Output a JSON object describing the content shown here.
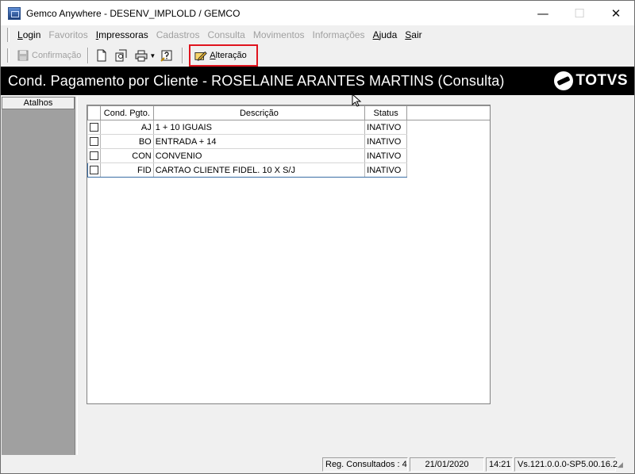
{
  "window": {
    "title": "Gemco Anywhere - DESENV_IMPLOLD / GEMCO",
    "controls": {
      "minimize": "—",
      "maximize": "☐",
      "close": "✕"
    }
  },
  "menubar": {
    "items": [
      {
        "label": "Login",
        "accel": "L",
        "rest": "ogin",
        "enabled": true
      },
      {
        "label": "Favoritos",
        "accel": "F",
        "rest": "avoritos",
        "enabled": false
      },
      {
        "label": "Impressoras",
        "accel": "I",
        "rest": "mpressoras",
        "enabled": true
      },
      {
        "label": "Cadastros",
        "accel": "C",
        "rest": "adastros",
        "enabled": false
      },
      {
        "label": "Consulta",
        "accel": "C",
        "rest": "onsulta",
        "enabled": false
      },
      {
        "label": "Movimentos",
        "accel": "M",
        "rest": "ovimentos",
        "enabled": false
      },
      {
        "label": "Informações",
        "accel": "I",
        "rest": "nformações",
        "enabled": false
      },
      {
        "label": "Ajuda",
        "accel": "A",
        "rest": "juda",
        "enabled": true
      },
      {
        "label": "Sair",
        "accel": "S",
        "rest": "air",
        "enabled": true
      }
    ]
  },
  "toolbar": {
    "confirm_label": "Confirmação",
    "alter_label_accel": "A",
    "alter_label_rest": "lteração",
    "highlight_color": "#e0141e"
  },
  "banner": {
    "title": "Cond. Pagamento por Cliente  - ROSELAINE ARANTES MARTINS (Consulta)",
    "logo_text": "TOTVS"
  },
  "sidebar": {
    "header": "Atalhos"
  },
  "grid": {
    "columns": [
      "",
      "Cond. Pgto.",
      "Descrição",
      "Status"
    ],
    "rows": [
      {
        "code": "AJ",
        "description": "1 + 10 IGUAIS",
        "status": "INATIVO"
      },
      {
        "code": "BO",
        "description": "ENTRADA + 14",
        "status": "INATIVO"
      },
      {
        "code": "CON",
        "description": "CONVENIO",
        "status": "INATIVO"
      },
      {
        "code": "FID",
        "description": "CARTAO CLIENTE FIDEL. 10 X S/J",
        "status": "INATIVO"
      }
    ]
  },
  "statusbar": {
    "records": "Reg. Consultados : 4",
    "date": "21/01/2020",
    "time": "14:21",
    "version": "Vs.121.0.0.0-SP5.00.16.2"
  }
}
